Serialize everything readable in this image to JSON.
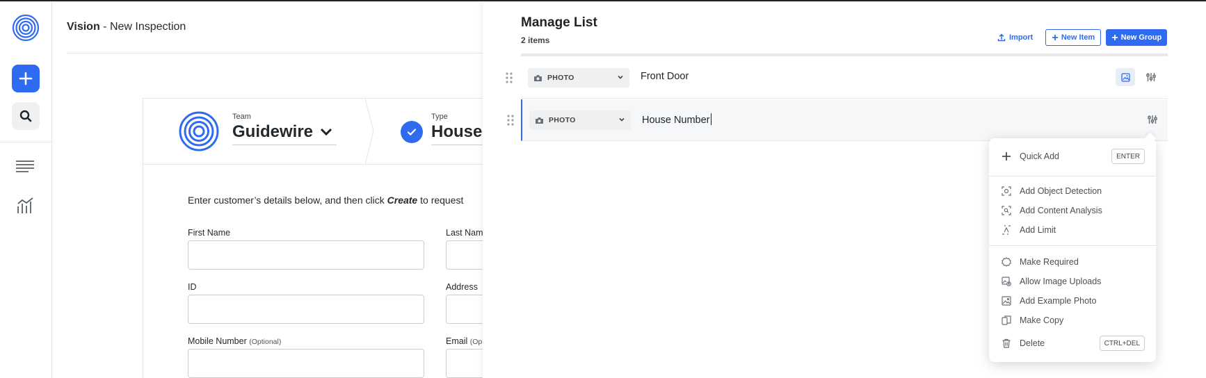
{
  "app": {
    "brand": "Vision",
    "page": " - New Inspection"
  },
  "rail": {
    "icons": [
      "vision-logo",
      "plus-icon",
      "search-icon",
      "list-icon",
      "chart-icon"
    ]
  },
  "card": {
    "team_label": "Team",
    "team_value": "Guidewire",
    "type_label": "Type",
    "type_value": "House",
    "intro_pre": "Enter customer’s details below, and then click ",
    "intro_em": "Create",
    "intro_post": " to request",
    "fields": {
      "first_name": "First Name",
      "last_name": "Last Nam",
      "id": "ID",
      "address": "Address",
      "mobile": "Mobile Number",
      "mobile_opt": "(Optional)",
      "email": "Email",
      "email_opt": "(Op"
    }
  },
  "panel": {
    "title": "Manage List",
    "count": "2 items",
    "import": "Import",
    "new_item": "New Item",
    "new_group": "New Group",
    "rows": [
      {
        "type": "PHOTO",
        "name": "Front Door"
      },
      {
        "type": "PHOTO",
        "name": "House Number"
      }
    ]
  },
  "menu": {
    "quick_add": "Quick Add",
    "quick_add_key": "ENTER",
    "object_detection": "Add Object Detection",
    "content_analysis": "Add Content Analysis",
    "limit": "Add Limit",
    "required": "Make Required",
    "uploads": "Allow Image Uploads",
    "example_photo": "Add Example Photo",
    "copy": "Make Copy",
    "delete": "Delete",
    "delete_key": "CTRL+DEL"
  },
  "colors": {
    "accent": "#2f6bf0",
    "text": "#1f2328",
    "muted": "#4a4f55",
    "border": "#e3e5e8"
  }
}
